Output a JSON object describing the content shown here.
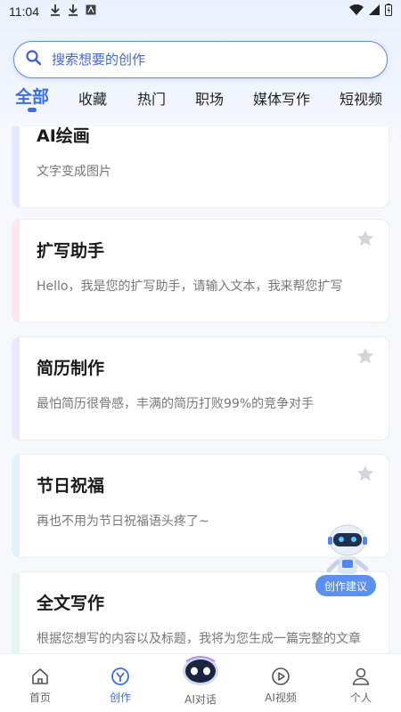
{
  "status": {
    "time": "11:04"
  },
  "search": {
    "placeholder": "搜索想要的创作"
  },
  "tabs": [
    {
      "label": "全部",
      "active": true
    },
    {
      "label": "收藏"
    },
    {
      "label": "热门"
    },
    {
      "label": "职场"
    },
    {
      "label": "媒体写作"
    },
    {
      "label": "短视频"
    }
  ],
  "cards": [
    {
      "title": "AI绘画",
      "desc": "文字变成图片",
      "accent": "#e3e8fb"
    },
    {
      "title": "扩写助手",
      "desc": "Hello，我是您的扩写助手，请输入文本，我来帮您扩写",
      "accent": "#fde7ec"
    },
    {
      "title": "简历制作",
      "desc": "最怕简历很骨感，丰满的简历打败99%的竞争对手",
      "accent": "#ece8fb"
    },
    {
      "title": "节日祝福",
      "desc": "再也不用为节日祝福语头疼了~",
      "accent": "#e4f2fc"
    },
    {
      "title": "全文写作",
      "desc": "根据您想写的内容以及标题，我将为您生成一篇完整的文章",
      "accent": "#e6f6ee"
    }
  ],
  "floating": {
    "label": "创作建议"
  },
  "nav": [
    {
      "label": "首页"
    },
    {
      "label": "创作",
      "active": true
    },
    {
      "label": "AI对话"
    },
    {
      "label": "AI视频"
    },
    {
      "label": "个人"
    }
  ],
  "colors": {
    "accent": "#3a6ee8",
    "star": "#d4d6db"
  }
}
